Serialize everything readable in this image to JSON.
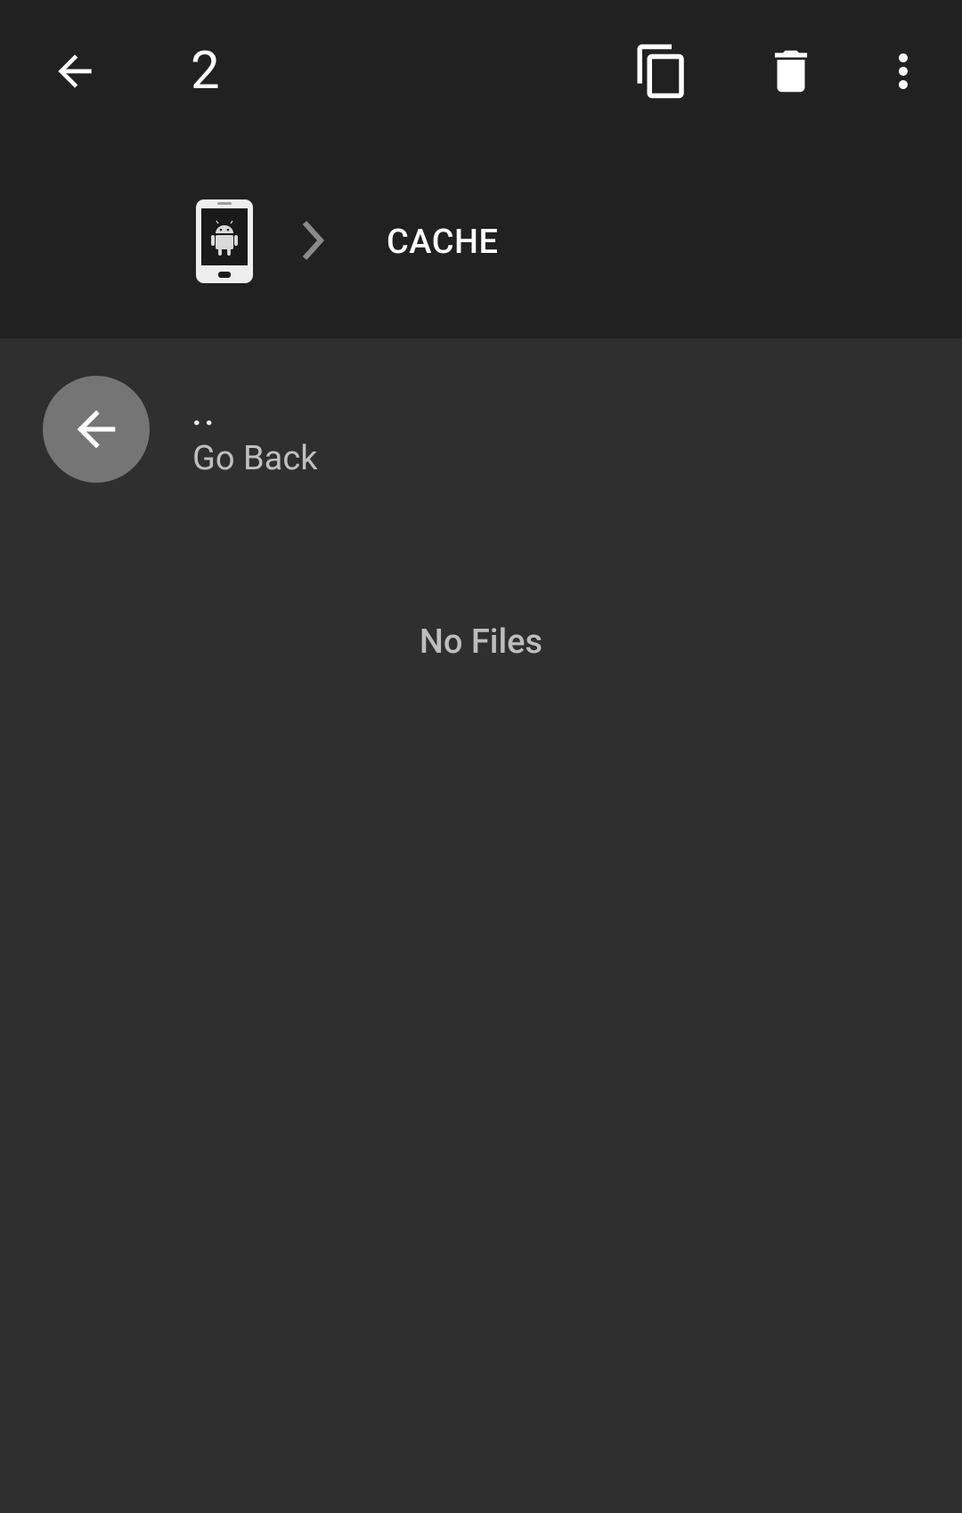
{
  "toolbar": {
    "selection_count": "2",
    "back_icon": "arrow-left-icon",
    "copy_icon": "copy-icon",
    "delete_icon": "delete-icon",
    "more_icon": "more-vertical-icon"
  },
  "breadcrumb": {
    "device_icon": "android-phone-icon",
    "separator_icon": "chevron-right-icon",
    "current": "CACHE"
  },
  "list": {
    "parent_item": {
      "name": "..",
      "subtitle": "Go Back",
      "icon": "arrow-left-icon"
    },
    "empty_message": "No Files"
  },
  "colors": {
    "appbar": "#212121",
    "background": "#2f2f2f",
    "avatar": "#757575",
    "secondary_text": "#c0c0c0"
  }
}
